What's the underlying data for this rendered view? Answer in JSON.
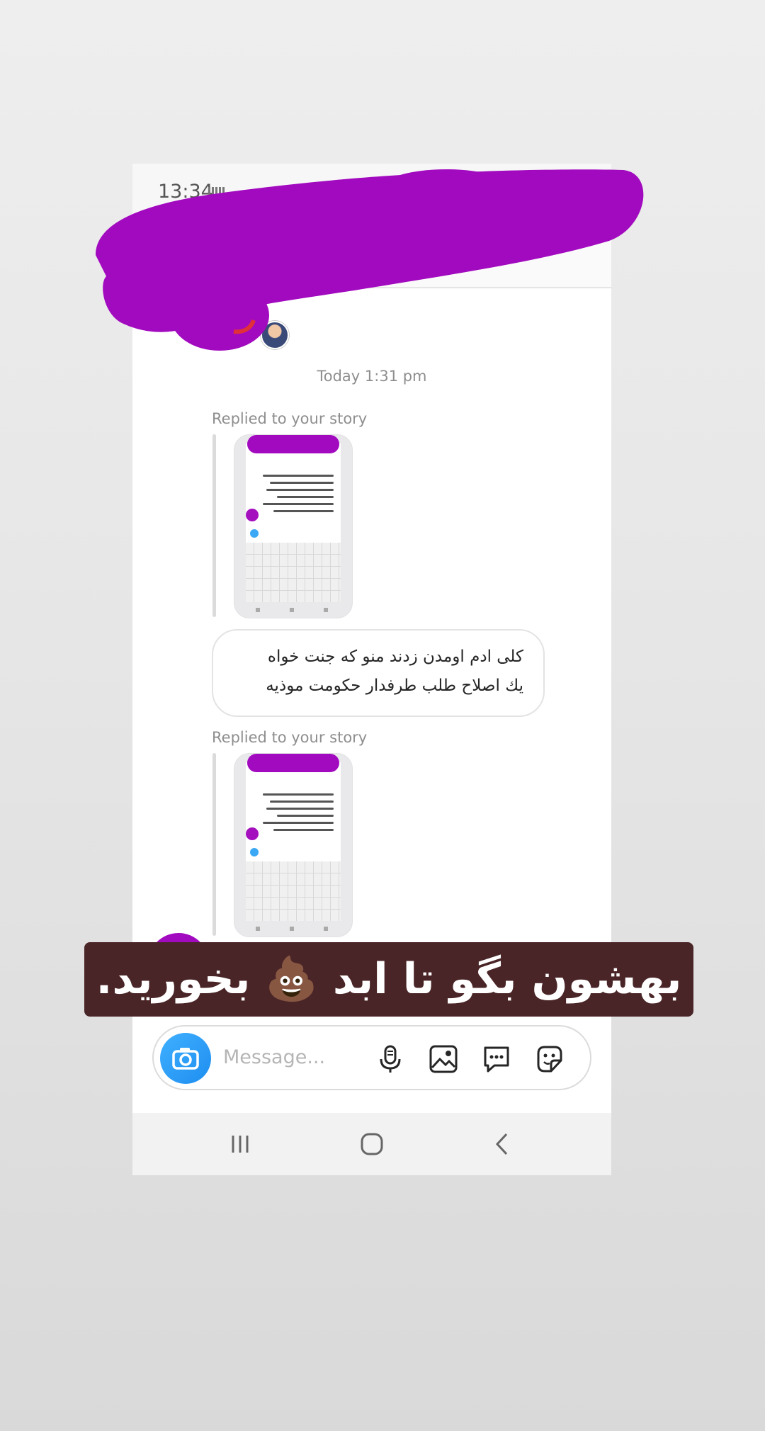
{
  "status_bar": {
    "time": "13:34"
  },
  "thread": {
    "timestamp": "Today 1:31 pm",
    "replies": [
      {
        "label": "Replied to your story"
      },
      {
        "label": "Replied to your story"
      }
    ],
    "message_lines": [
      "کلی ادم اومدن زدند منو که جنت خواه",
      "يك اصلاح طلب طرفدار حکومت موذیه"
    ]
  },
  "composer": {
    "placeholder": "Message...",
    "icons": [
      "camera-icon",
      "microphone-icon",
      "gallery-icon",
      "chat-bubble-icon",
      "sticker-icon"
    ]
  },
  "nav": {
    "icons": [
      "recent-apps-icon",
      "home-icon",
      "back-icon"
    ]
  },
  "caption": {
    "text": "بهشون بگو تا ابد 💩 بخورید."
  },
  "colors": {
    "redaction": "#a20abf",
    "caption_bg": "#4a2527",
    "accent_blue": "#1e8ef0"
  }
}
